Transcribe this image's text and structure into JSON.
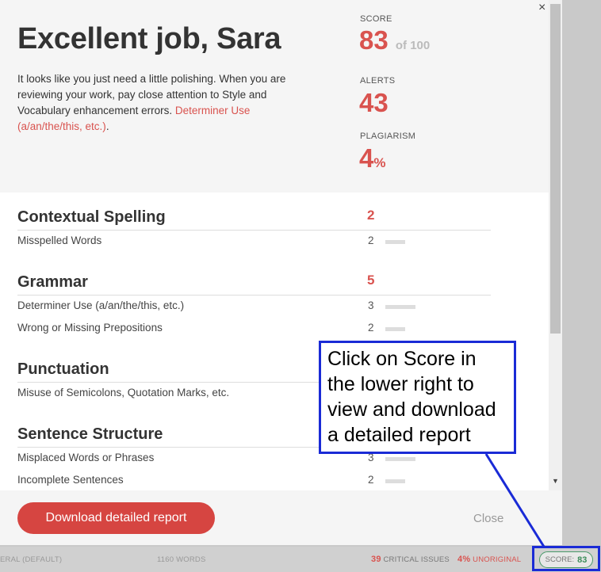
{
  "summary": {
    "headline": "Excellent job, Sara",
    "text_before": "It looks like you just need a little polishing. When you are reviewing your work, pay close attention to Style and Vocabulary enhancement errors. ",
    "text_link": "Determiner Use (a/an/the/this, etc.)",
    "text_after": ".",
    "score_label": "SCORE",
    "score_value": "83",
    "score_suffix": "of 100",
    "alerts_label": "ALERTS",
    "alerts_value": "43",
    "plagiarism_label": "PLAGIARISM",
    "plagiarism_value": "4",
    "plagiarism_suffix": "%",
    "close_symbol": "×"
  },
  "categories": [
    {
      "title": "Contextual Spelling",
      "count": "2",
      "items": [
        {
          "label": "Misspelled Words",
          "count": "2",
          "fraction": 0.67
        }
      ]
    },
    {
      "title": "Grammar",
      "count": "5",
      "items": [
        {
          "label": "Determiner Use (a/an/the/this, etc.)",
          "count": "3",
          "fraction": 1.0
        },
        {
          "label": "Wrong or Missing Prepositions",
          "count": "2",
          "fraction": 0.67
        }
      ]
    },
    {
      "title": "Punctuation",
      "count": "",
      "items": [
        {
          "label": "Misuse of Semicolons, Quotation Marks, etc.",
          "count": "",
          "fraction": 0
        }
      ]
    },
    {
      "title": "Sentence Structure",
      "count": "",
      "items": [
        {
          "label": "Misplaced Words or Phrases",
          "count": "3",
          "fraction": 1.0
        },
        {
          "label": "Incomplete Sentences",
          "count": "2",
          "fraction": 0.67
        }
      ]
    }
  ],
  "footer": {
    "download_label": "Download detailed report",
    "close_label": "Close"
  },
  "statusbar": {
    "mode_label": "ERAL (DEFAULT)",
    "word_count": "1160 WORDS",
    "critical_count": "39",
    "critical_label": "CRITICAL ISSUES",
    "unoriginal_percent": "4%",
    "unoriginal_label": "UNORIGINAL",
    "score_label": "SCORE:",
    "score_value": "83"
  },
  "callout": {
    "text": "Click on Score in the lower right to view and download a detailed report"
  },
  "colors": {
    "accent_red": "#d9534f",
    "button_red": "#d64541",
    "annotation_blue": "#1a2bd6",
    "score_green": "#3c8d5a"
  }
}
